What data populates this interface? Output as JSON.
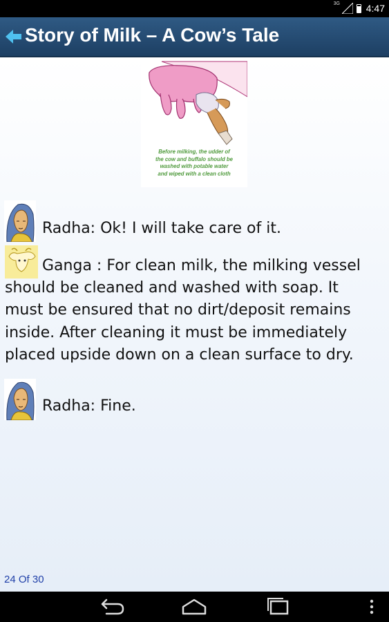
{
  "status_bar": {
    "network_label": "3G",
    "time": "4:47"
  },
  "action_bar": {
    "title": "Story of Milk – A Cow’s Tale",
    "back_icon": "back-arrow-icon"
  },
  "illustration": {
    "caption_lines": [
      "Before milking, the udder of",
      "the cow and buffalo should be",
      "washed with potable water",
      "and wiped with a clean cloth"
    ],
    "colors": {
      "udder": "#f0a0c8",
      "caption": "#4f9a3c"
    }
  },
  "dialogue": [
    {
      "speaker_icon": "radha-avatar",
      "lines": [
        "Radha: Ok! I will take care of it."
      ]
    },
    {
      "speaker_icon": "ganga-cow-avatar",
      "lines": [
        "Ganga  : For clean milk, the milking vessel",
        "should be cleaned and washed with soap. It",
        "must be ensured that no dirt/deposit remains",
        "inside. After cleaning it must be immediately",
        "placed upside down on a clean surface to dry."
      ]
    },
    {
      "speaker_icon": "radha-avatar",
      "lines": [
        "Radha: Fine."
      ]
    }
  ],
  "pager": {
    "text": "24 Of 30"
  },
  "nav_bar": {
    "icons": [
      "back-icon",
      "home-icon",
      "recents-icon",
      "menu-icon"
    ]
  }
}
